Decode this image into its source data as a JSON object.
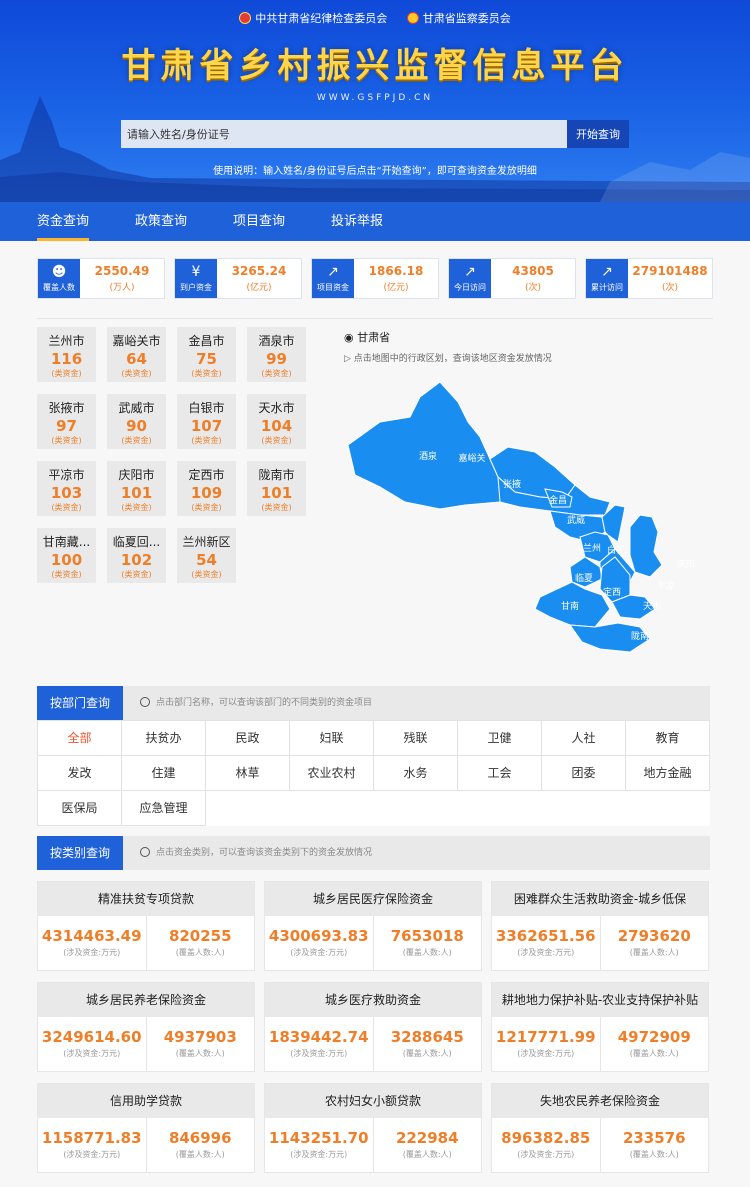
{
  "header": {
    "org1": "中共甘肃省纪律检查委员会",
    "org2": "甘肃省监察委员会",
    "title": "甘肃省乡村振兴监督信息平台",
    "url": "WWW.GSFPJD.CN",
    "search_placeholder": "请输入姓名/身份证号",
    "search_button": "开始查询",
    "hint": "使用说明：输入姓名/身份证号后点击“开始查询”，即可查询资金发放明细",
    "colors": {
      "primary": "#1f61d9",
      "title": "#ffd64a",
      "accent": "#ef7e28"
    }
  },
  "nav": [
    "资金查询",
    "政策查询",
    "项目查询",
    "投诉举报"
  ],
  "stats": [
    {
      "label": "覆盖人数",
      "value": "2550.49",
      "unit": "(万人)",
      "icon": "person-icon"
    },
    {
      "label": "到户资金",
      "value": "3265.24",
      "unit": "(亿元)",
      "icon": "money-bag-icon"
    },
    {
      "label": "项目资金",
      "value": "1866.18",
      "unit": "(亿元)",
      "icon": "trend-icon"
    },
    {
      "label": "今日访问",
      "value": "43805",
      "unit": "(次)",
      "icon": "trend-icon"
    },
    {
      "label": "累计访问",
      "value": "279101488",
      "unit": "(次)",
      "icon": "trend-icon"
    }
  ],
  "cities": [
    {
      "name": "兰州市",
      "value": "116",
      "unit": "(类资金)"
    },
    {
      "name": "嘉峪关市",
      "value": "64",
      "unit": "(类资金)"
    },
    {
      "name": "金昌市",
      "value": "75",
      "unit": "(类资金)"
    },
    {
      "name": "酒泉市",
      "value": "99",
      "unit": "(类资金)"
    },
    {
      "name": "张掖市",
      "value": "97",
      "unit": "(类资金)"
    },
    {
      "name": "武威市",
      "value": "90",
      "unit": "(类资金)"
    },
    {
      "name": "白银市",
      "value": "107",
      "unit": "(类资金)"
    },
    {
      "name": "天水市",
      "value": "104",
      "unit": "(类资金)"
    },
    {
      "name": "平凉市",
      "value": "103",
      "unit": "(类资金)"
    },
    {
      "name": "庆阳市",
      "value": "101",
      "unit": "(类资金)"
    },
    {
      "name": "定西市",
      "value": "109",
      "unit": "(类资金)"
    },
    {
      "name": "陇南市",
      "value": "101",
      "unit": "(类资金)"
    },
    {
      "name": "甘南藏...",
      "value": "100",
      "unit": "(类资金)"
    },
    {
      "name": "临夏回...",
      "value": "102",
      "unit": "(类资金)"
    },
    {
      "name": "兰州新区",
      "value": "54",
      "unit": "(类资金)"
    }
  ],
  "map": {
    "province": "甘肃省",
    "hint": "点击地图中的行政区划，查询该地区资金发放情况",
    "fill": "#1a8ef0",
    "labels": [
      "酒泉",
      "嘉峪关",
      "张掖",
      "金昌",
      "武威",
      "兰州",
      "白银",
      "庆阳",
      "平凉",
      "临夏",
      "定西",
      "天水",
      "甘南",
      "陇南"
    ]
  },
  "dept_section": {
    "title": "按部门查询",
    "hint": "点击部门名称，可以查询该部门的不同类别的资金项目",
    "rows": [
      [
        "全部",
        "扶贫办",
        "民政",
        "妇联",
        "残联",
        "卫健",
        "人社",
        "教育"
      ],
      [
        "发改",
        "住建",
        "林草",
        "农业农村",
        "水务",
        "工会",
        "团委",
        "地方金融"
      ],
      [
        "医保局",
        "应急管理"
      ]
    ]
  },
  "category_section": {
    "title": "按类别查询",
    "hint": "点击资金类别，可以查询该资金类别下的资金发放情况",
    "amount_label": "(涉及资金:万元)",
    "people_label": "(覆盖人数:人)",
    "items": [
      {
        "name": "精准扶贫专项贷款",
        "amount": "4314463.49",
        "people": "820255"
      },
      {
        "name": "城乡居民医疗保险资金",
        "amount": "4300693.83",
        "people": "7653018"
      },
      {
        "name": "困难群众生活救助资金-城乡低保",
        "amount": "3362651.56",
        "people": "2793620"
      },
      {
        "name": "城乡居民养老保险资金",
        "amount": "3249614.60",
        "people": "4937903"
      },
      {
        "name": "城乡医疗救助资金",
        "amount": "1839442.74",
        "people": "3288645"
      },
      {
        "name": "耕地地力保护补贴-农业支持保护补贴",
        "amount": "1217771.99",
        "people": "4972909"
      },
      {
        "name": "信用助学贷款",
        "amount": "1158771.83",
        "people": "846996"
      },
      {
        "name": "农村妇女小额贷款",
        "amount": "1143251.70",
        "people": "222984"
      },
      {
        "name": "失地农民养老保险资金",
        "amount": "896382.85",
        "people": "233576"
      }
    ]
  }
}
